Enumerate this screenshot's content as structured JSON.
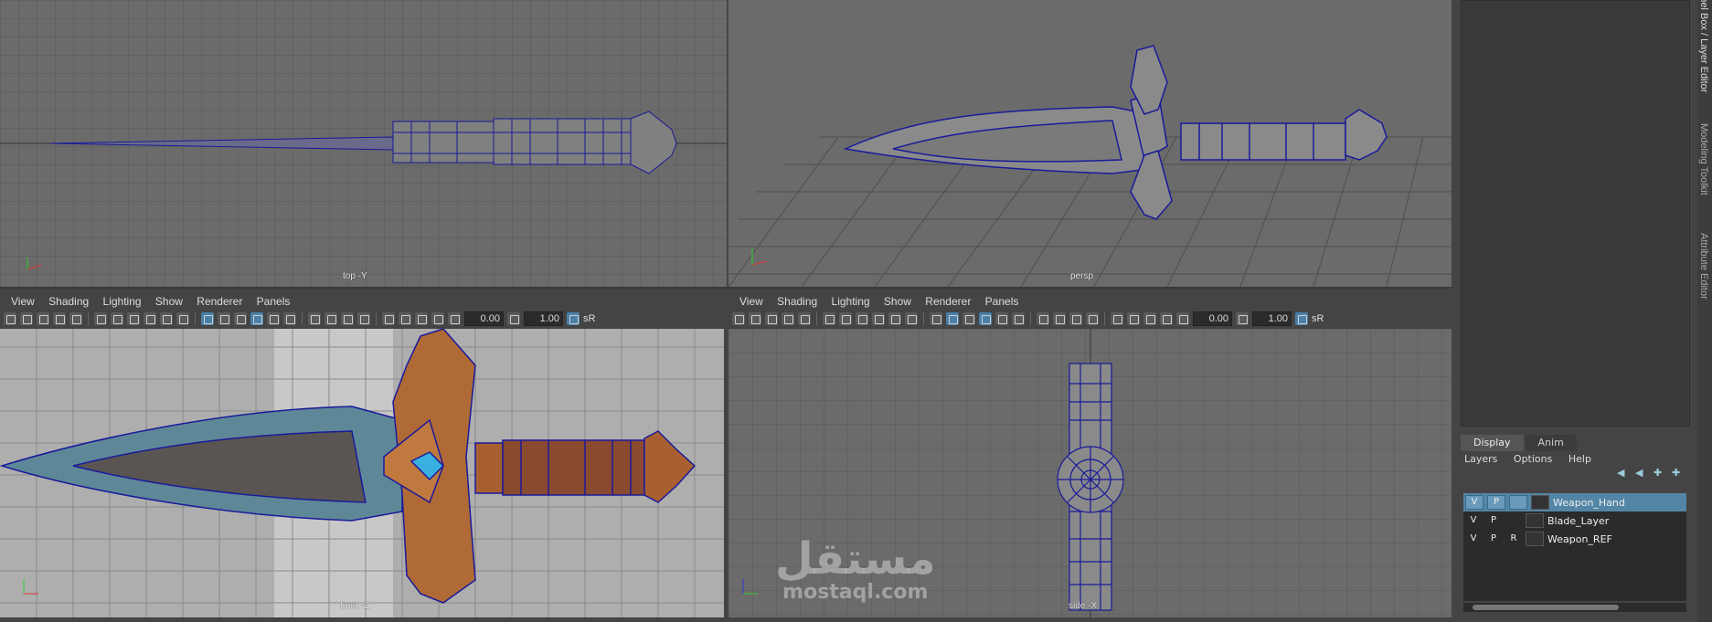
{
  "viewports": {
    "top": {
      "label": "top -Y"
    },
    "persp": {
      "label": "persp"
    },
    "front": {
      "label": "front -Z"
    },
    "side": {
      "label": "side -X"
    }
  },
  "panel_menu": {
    "items": [
      "View",
      "Shading",
      "Lighting",
      "Show",
      "Renderer",
      "Panels"
    ]
  },
  "toolbar": {
    "field1": "0.00",
    "field2": "1.00",
    "srgb": "sR"
  },
  "side_tabs": [
    "Channel Box / Layer Editor",
    "Modeling Toolkit",
    "Attribute Editor"
  ],
  "layer_editor": {
    "tabs": [
      "Display",
      "Anim"
    ],
    "menus": [
      "Layers",
      "Options",
      "Help"
    ],
    "layers": [
      {
        "v": "V",
        "p": "P",
        "r": "",
        "name": "Weapon_Hand",
        "selected": true
      },
      {
        "v": "V",
        "p": "P",
        "r": "",
        "name": "Blade_Layer",
        "selected": false
      },
      {
        "v": "V",
        "p": "P",
        "r": "R",
        "name": "Weapon_REF",
        "selected": false
      }
    ]
  },
  "watermark": {
    "arabic": "مستقل",
    "latin": "mostaql.com"
  },
  "colors": {
    "wire": "#1a1a9a",
    "selected_layer": "#5285a6",
    "viewport_bg": "#6a6a6a"
  }
}
